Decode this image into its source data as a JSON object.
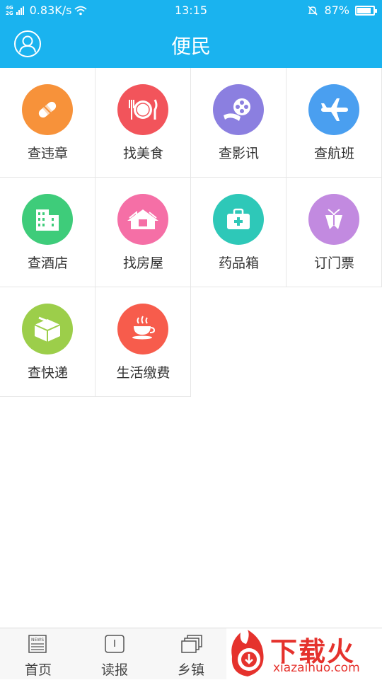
{
  "status_bar": {
    "network_top": "4G",
    "network_bottom": "2G",
    "speed": "0.83K/s",
    "time": "13:15",
    "battery": "87%",
    "battery_level": 0.87
  },
  "header": {
    "title": "便民",
    "avatar_icon": "user-icon"
  },
  "services": [
    {
      "label": "查违章",
      "icon": "bandage-icon",
      "color": "#f7923a"
    },
    {
      "label": "找美食",
      "icon": "dining-icon",
      "color": "#f2545b"
    },
    {
      "label": "查影讯",
      "icon": "film-reel-icon",
      "color": "#8b7fe0"
    },
    {
      "label": "查航班",
      "icon": "airplane-icon",
      "color": "#4a9ff0"
    },
    {
      "label": "查酒店",
      "icon": "hotel-icon",
      "color": "#3ecc7a"
    },
    {
      "label": "找房屋",
      "icon": "house-icon",
      "color": "#f56fa6"
    },
    {
      "label": "药品箱",
      "icon": "medical-kit-icon",
      "color": "#2ec8b8"
    },
    {
      "label": "订门票",
      "icon": "ticket-gift-icon",
      "color": "#c28ae0"
    },
    {
      "label": "查快递",
      "icon": "package-icon",
      "color": "#9cce4a"
    },
    {
      "label": "生活缴费",
      "icon": "coffee-cup-icon",
      "color": "#f75c4c"
    }
  ],
  "bottom_tabs": [
    {
      "label": "首页",
      "icon": "news-icon"
    },
    {
      "label": "读报",
      "icon": "newspaper-read-icon"
    },
    {
      "label": "乡镇",
      "icon": "layers-icon"
    }
  ],
  "watermark": {
    "text": "下载火",
    "url": "xiazaihuo.com"
  }
}
